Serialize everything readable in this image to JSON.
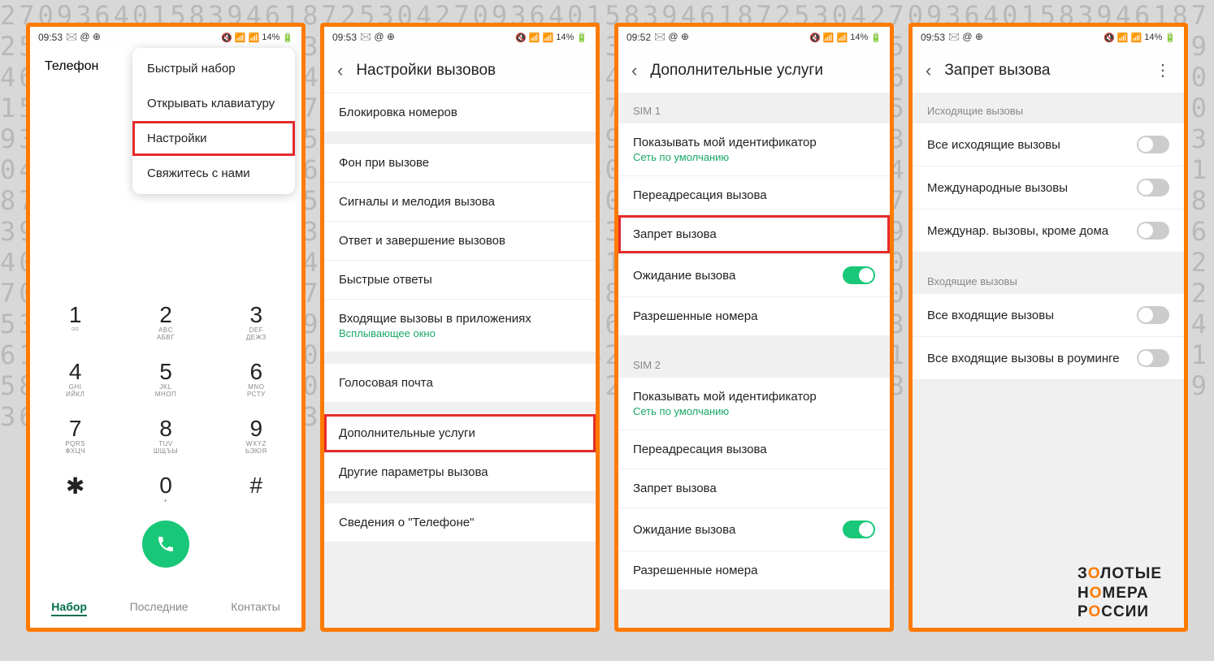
{
  "bg_numbers": "27093640158394618725304270936401583946187253042709364015839461872530427093640158394618725304270936401583946187253042709364015839461872530427093640158394618725304270936401583946187253042709364015839461872530427093640158394618725304270936401583946187253042709364015839461872530427093640158394618725304270936401583946187253042709364015839461872530427093640158394618725304270936401583946187253042709364015839461872530427093640158394618725304270936401583946187253042709364015839461872530427093640158394618725304270936401583946187253042709364015839461872530427093640158394618725304270936401583946187253042709364015839461872530427093640158394618725304270936401583946187253042709364015839461872530427093640158394618725304270936401583946187253042709364015839461872530427093640158394618725304270936401583946187253042709364015839461872530427093640158394618725304",
  "status": {
    "time1": "09:53",
    "time2": "09:53",
    "time3": "09:52",
    "time4": "09:53",
    "battery": "14%",
    "icons": "🖂 @ ⊕"
  },
  "screen1": {
    "title": "Телефон",
    "menu": [
      "Быстрый набор",
      "Открывать клавиатуру",
      "Настройки",
      "Свяжитесь с нами"
    ],
    "keys": [
      {
        "n": "1",
        "s": "ᴼᴼ"
      },
      {
        "n": "2",
        "s": "ABC\nАБВГ"
      },
      {
        "n": "3",
        "s": "DEF\nДЕЖЗ"
      },
      {
        "n": "4",
        "s": "GHI\nИЙКЛ"
      },
      {
        "n": "5",
        "s": "JKL\nМНОП"
      },
      {
        "n": "6",
        "s": "MNO\nРСТУ"
      },
      {
        "n": "7",
        "s": "PQRS\nФХЦЧ"
      },
      {
        "n": "8",
        "s": "TUV\nШЩЪЫ"
      },
      {
        "n": "9",
        "s": "WXYZ\nЬЭЮЯ"
      },
      {
        "n": "✱",
        "s": ""
      },
      {
        "n": "0",
        "s": "+"
      },
      {
        "n": "#",
        "s": ""
      }
    ],
    "tabs": [
      "Набор",
      "Последние",
      "Контакты"
    ]
  },
  "screen2": {
    "title": "Настройки вызовов",
    "group1": [
      "Блокировка номеров"
    ],
    "group2": [
      "Фон при вызове",
      "Сигналы и мелодия вызова",
      "Ответ и завершение вызовов",
      "Быстрые ответы"
    ],
    "app_calls": {
      "label": "Входящие вызовы в приложениях",
      "sub": "Всплывающее окно"
    },
    "group3": [
      "Голосовая почта"
    ],
    "group4": [
      "Дополнительные услуги",
      "Другие параметры вызова"
    ],
    "group5": [
      "Сведения о \"Телефоне\""
    ]
  },
  "screen3": {
    "title": "Дополнительные услуги",
    "sim1_label": "SIM 1",
    "sim2_label": "SIM 2",
    "caller_id": {
      "label": "Показывать мой идентификатор",
      "sub": "Сеть по умолчанию"
    },
    "forward": "Переадресация вызова",
    "barring": "Запрет вызова",
    "waiting": "Ожидание вызова",
    "allowed": "Разрешенные номера"
  },
  "screen4": {
    "title": "Запрет вызова",
    "out_header": "Исходящие вызовы",
    "out": [
      "Все исходящие вызовы",
      "Международные вызовы",
      "Междунар. вызовы, кроме дома"
    ],
    "in_header": "Входящие вызовы",
    "in": [
      "Все входящие вызовы",
      "Все входящие вызовы в роуминге"
    ]
  },
  "logo": {
    "l1": "ЗОЛОТЫЕ",
    "l2": "НОМЕРА",
    "l3": "РОССИИ"
  }
}
